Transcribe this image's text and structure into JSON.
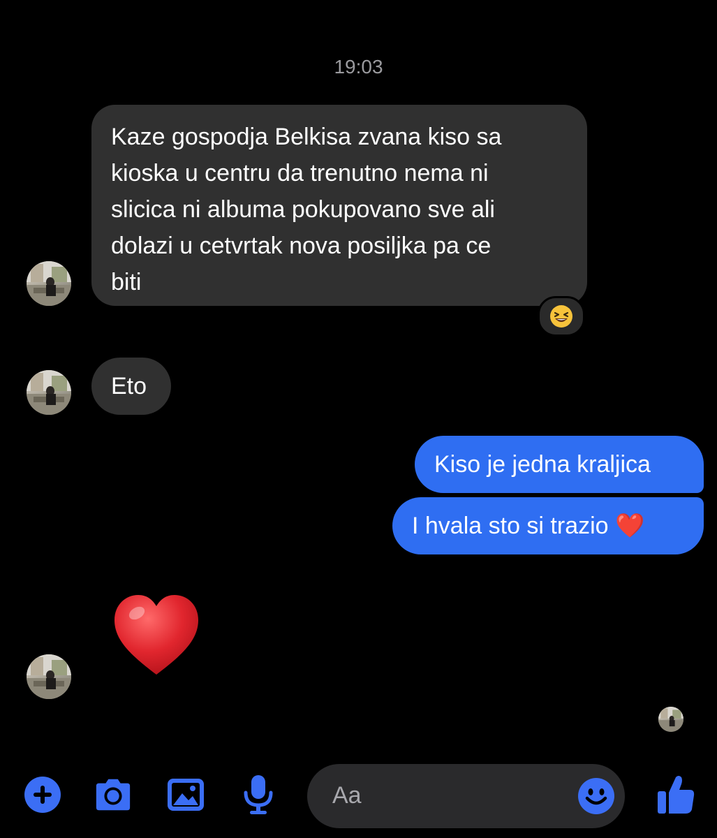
{
  "conversation": {
    "timestamp": "19:03"
  },
  "messages": {
    "incoming_1": {
      "lines": [
        "Kaze gospodja Belkisa zvana kiso sa",
        "kioska u centru da trenutno nema ni",
        "slicica ni albuma pokupovano sve ali",
        "dolazi u cetvrtak nova posiljka pa ce",
        "biti"
      ],
      "reaction": "😆"
    },
    "incoming_2": {
      "text": "Eto"
    },
    "outgoing_1": {
      "text": "Kiso je jedna kraljica"
    },
    "outgoing_2": {
      "text": "I hvala sto si trazio ❤️"
    },
    "incoming_3": {
      "emoji": "heart-emoji"
    }
  },
  "composer": {
    "placeholder": "Aa",
    "icons": [
      "plus-icon",
      "camera-icon",
      "image-icon",
      "microphone-icon",
      "emoji-icon",
      "thumbs-up-icon"
    ]
  },
  "colors": {
    "background": "#000000",
    "incoming_bubble": "#303030",
    "outgoing_bubble": "#2f6ef2",
    "accent": "#3b6ef5",
    "heart": "#e1262e"
  }
}
